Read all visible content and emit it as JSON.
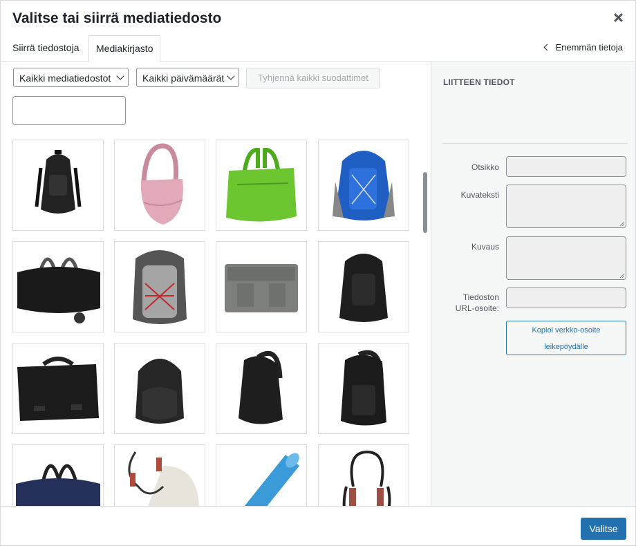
{
  "dialog": {
    "title": "Valitse tai siirrä mediatiedosto"
  },
  "tabs": [
    {
      "label": "Siirrä tiedostoja"
    },
    {
      "label": "Mediakirjasto"
    }
  ],
  "more_details": {
    "label": "Enemmän tietoja"
  },
  "filters": {
    "media_type": "Kaikki mediatiedostot",
    "dates": "Kaikki päivämäärät",
    "clear_label": "Tyhjennä kaikki suodattimet",
    "search_value": ""
  },
  "media_items": [
    "black-backpack",
    "pink-shoulder-bag",
    "green-duffel-bag",
    "blue-backpack",
    "black-rolling-duffel",
    "grey-red-backpack",
    "grey-messenger-bag",
    "black-backpack-small",
    "black-messenger-bag",
    "black-round-backpack",
    "black-sling-bag",
    "black-sling-backpack",
    "navy-duffel-bag",
    "jump-rope-and-bag",
    "blue-foam-roller",
    "black-jump-rope"
  ],
  "attachment_details": {
    "heading": "LIITTEEN TIEDOT",
    "title_label": "Otsikko",
    "caption_label": "Kuvateksti",
    "description_label": "Kuvaus",
    "url_label_line1": "Tiedoston",
    "url_label_line2": "URL-osoite:",
    "copy_line1": "Kopioi verkko-osoite",
    "copy_line2": "leikepöydälle"
  },
  "footer": {
    "select_label": "Valitse"
  },
  "colors": {
    "primary": "#2271b1",
    "border": "#dcdcde",
    "sidebar_bg": "#f6f7f7"
  }
}
